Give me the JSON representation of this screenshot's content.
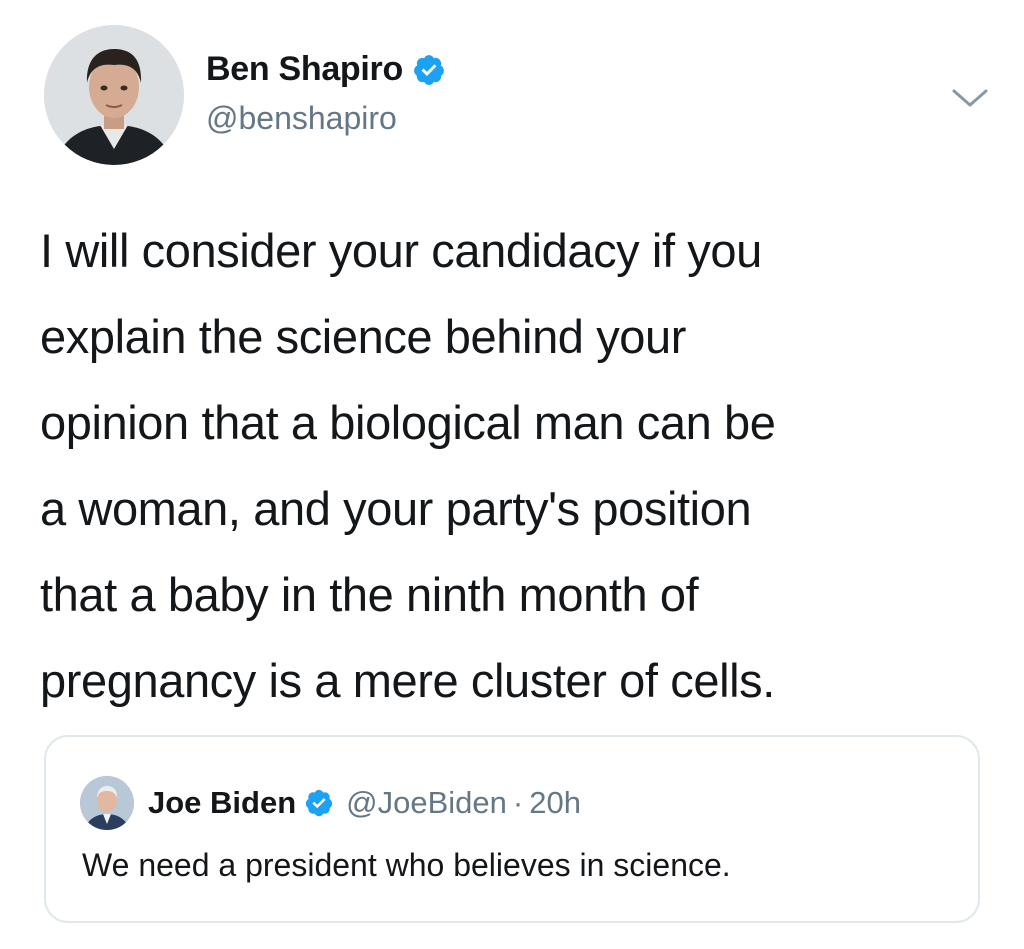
{
  "tweet": {
    "author": {
      "display_name": "Ben Shapiro",
      "handle": "@benshapiro",
      "verified": true
    },
    "text": "I will consider your candidacy if you\nexplain the science behind your\nopinion that a biological man can be\na woman, and your party's position\nthat a baby in the ninth month of\npregnancy is a mere cluster of cells.",
    "menu_icon": "chevron-down-icon"
  },
  "quoted_tweet": {
    "author": {
      "display_name": "Joe Biden",
      "handle": "@JoeBiden",
      "verified": true
    },
    "separator": "·",
    "time": "20h",
    "text": "We need a president who believes in science."
  },
  "colors": {
    "text_primary": "#14171a",
    "text_secondary": "#657786",
    "verified_blue": "#1da1f2",
    "card_border": "#e1e8ed"
  }
}
